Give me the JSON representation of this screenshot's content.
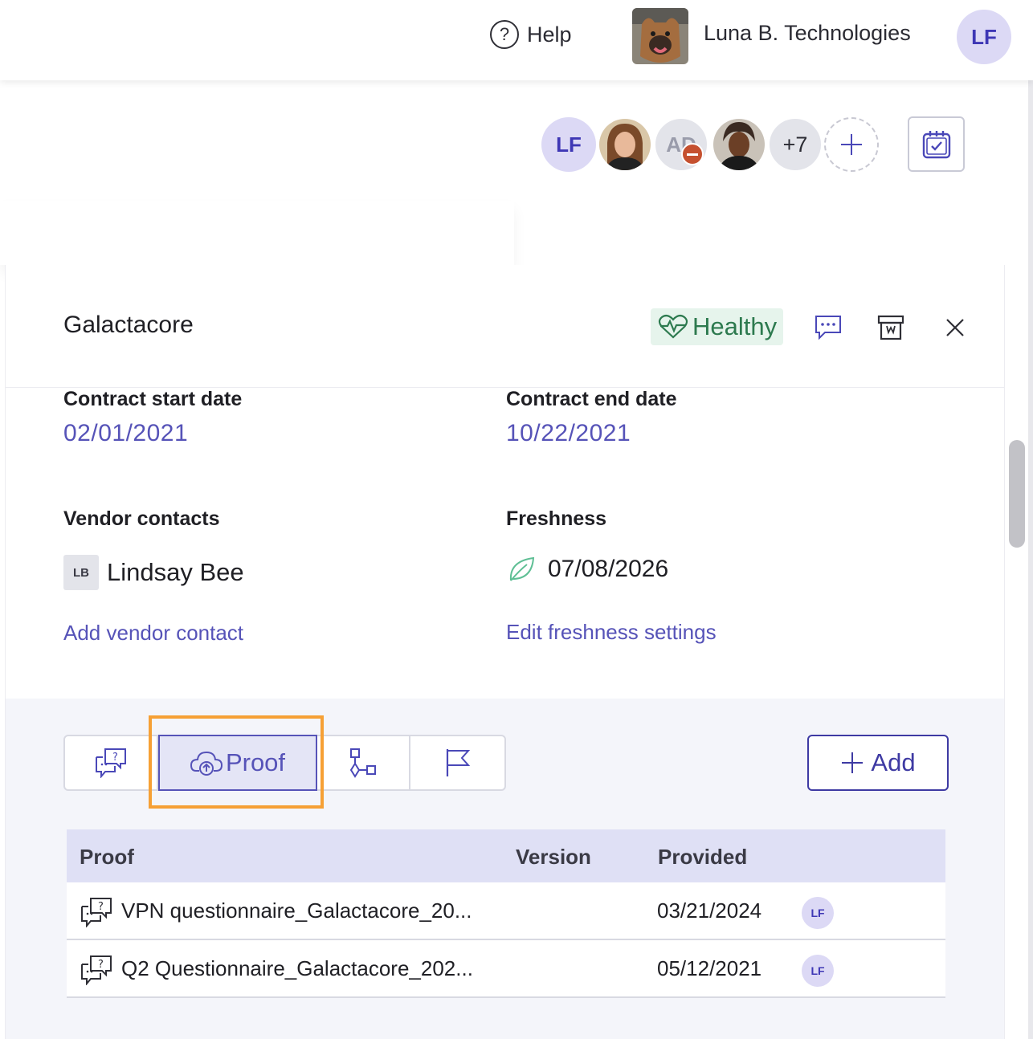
{
  "header": {
    "help_label": "Help",
    "org_name": "Luna B. Technologies",
    "user_initials": "LF"
  },
  "collaborators": {
    "first_initials": "LF",
    "ad_initials": "AD",
    "more_count": "+7"
  },
  "panel": {
    "title": "Galactacore",
    "health_label": "Healthy",
    "fields": {
      "contract_start_label": "Contract start date",
      "contract_start_value": "02/01/2021",
      "contract_end_label": "Contract end date",
      "contract_end_value": "10/22/2021",
      "vendor_contacts_label": "Vendor contacts",
      "contact_initials": "LB",
      "contact_name": "Lindsay Bee",
      "add_contact_link": "Add vendor contact",
      "freshness_label": "Freshness",
      "freshness_date": "07/08/2026",
      "edit_freshness_link": "Edit freshness settings"
    }
  },
  "proof": {
    "tab_proof_label": "Proof",
    "add_label": "Add",
    "columns": [
      "Proof",
      "Version",
      "Provided"
    ],
    "rows": [
      {
        "name": "VPN questionnaire_Galactacore_20...",
        "version": "",
        "provided": "03/21/2024",
        "initials": "LF"
      },
      {
        "name": "Q2 Questionnaire_Galactacore_202...",
        "version": "",
        "provided": "05/12/2021",
        "initials": "LF"
      }
    ]
  },
  "colors": {
    "accent": "#5653b8",
    "healthy_bg": "#e6f4ec",
    "healthy_fg": "#2d7a4f",
    "highlight": "#f6a035"
  }
}
